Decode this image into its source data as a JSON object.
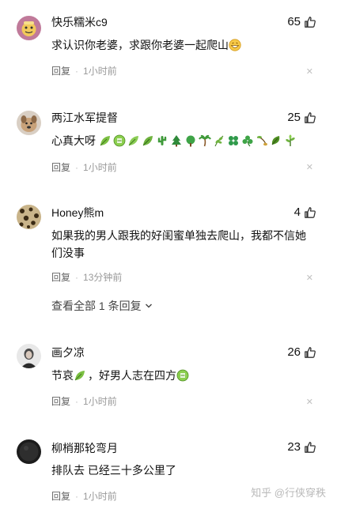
{
  "comments": [
    {
      "username": "快乐糯米c9",
      "likes": "65",
      "text": "求认识你老婆，求跟你老婆一起爬山",
      "reply": "回复",
      "time": "1小时前",
      "avatar": "cartoon-avatar",
      "emoji": [
        "grin-emoji"
      ]
    },
    {
      "username": "两江水军提督",
      "likes": "25",
      "text": "心真大呀",
      "reply": "回复",
      "time": "1小时前",
      "avatar": "dog-avatar",
      "emoji": [
        "leaf-emoji",
        "bitter-emoji",
        "leaf-emoji",
        "leaf-emoji",
        "cactus-emoji",
        "tree-emoji",
        "tree-emoji",
        "palm-emoji",
        "herb-emoji",
        "clover-emoji",
        "shamrock-emoji",
        "sprout-emoji",
        "leaf-emoji",
        "plant-emoji"
      ]
    },
    {
      "username": "Honey熊m",
      "likes": "4",
      "text": "如果我的男人跟我的好闺蜜单独去爬山，我都不信她们没事",
      "reply": "回复",
      "time": "13分钟前",
      "avatar": "leopard-avatar"
    },
    {
      "username": "画夕凉",
      "likes": "26",
      "text_before": "节哀",
      "text_after": "，好男人志在四方",
      "reply": "回复",
      "time": "1小时前",
      "avatar": "portrait-avatar"
    },
    {
      "username": "柳梢那轮弯月",
      "likes": "23",
      "text": "排队去 已经三十多公里了",
      "reply": "回复",
      "time": "1小时前",
      "avatar": "dark-avatar"
    }
  ],
  "view_all": "查看全部 1 条回复",
  "watermark": "知乎 @行侠穿秩",
  "colors": {
    "meta": "#8590a6",
    "text": "#121212",
    "emoji_green": "#6fb33f"
  }
}
